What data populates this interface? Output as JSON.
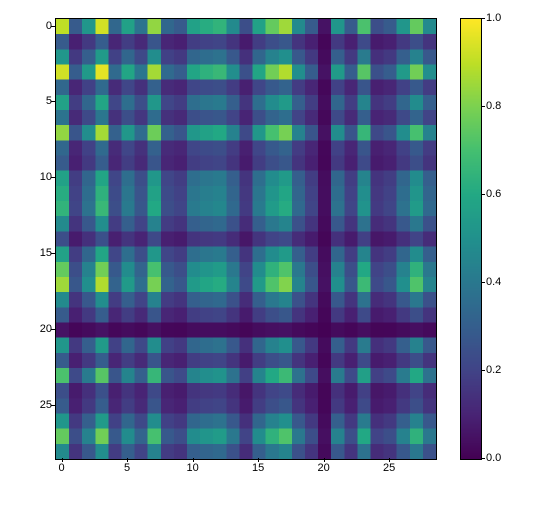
{
  "chart_data": {
    "type": "heatmap",
    "n": 29,
    "x_ticks": [
      0,
      5,
      10,
      15,
      20,
      25
    ],
    "y_ticks": [
      0,
      5,
      10,
      15,
      20,
      25
    ],
    "colorbar_ticks": [
      0.0,
      0.2,
      0.4,
      0.6,
      0.8,
      1.0
    ],
    "colorbar_labels": [
      "0.0",
      "0.2",
      "0.4",
      "0.6",
      "0.8",
      "1.0"
    ],
    "vmin": 0.0,
    "vmax": 1.0,
    "pattern_w": [
      0.95,
      0.3,
      0.55,
      0.98,
      0.35,
      0.6,
      0.4,
      0.88,
      0.35,
      0.3,
      0.6,
      0.65,
      0.68,
      0.5,
      0.25,
      0.6,
      0.8,
      0.9,
      0.5,
      0.3,
      0.05,
      0.55,
      0.3,
      0.75,
      0.25,
      0.3,
      0.55,
      0.8,
      0.5
    ]
  }
}
